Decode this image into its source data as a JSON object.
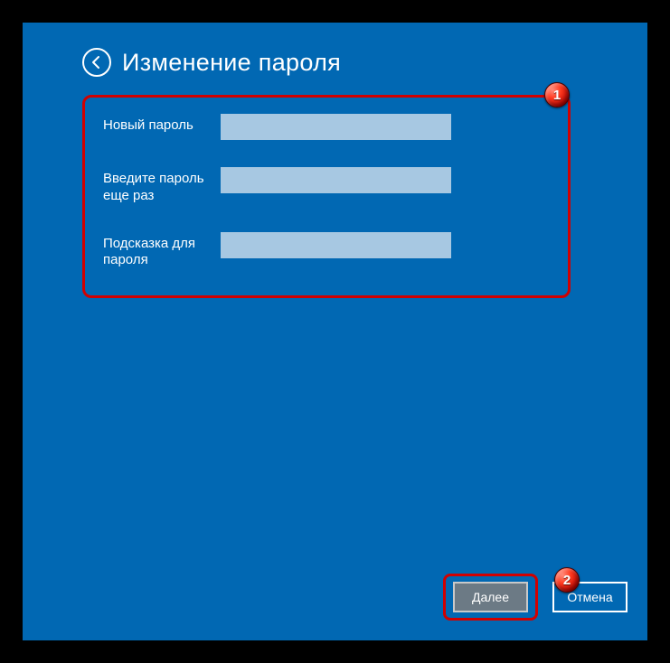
{
  "title": "Изменение пароля",
  "form": {
    "rows": [
      {
        "label": "Новый пароль",
        "value": "",
        "type": "password"
      },
      {
        "label": "Введите пароль еще раз",
        "value": "",
        "type": "password"
      },
      {
        "label": "Подсказка для пароля",
        "value": "",
        "type": "text"
      }
    ]
  },
  "buttons": {
    "next": "Далее",
    "cancel": "Отмена"
  },
  "callouts": {
    "one": "1",
    "two": "2"
  }
}
